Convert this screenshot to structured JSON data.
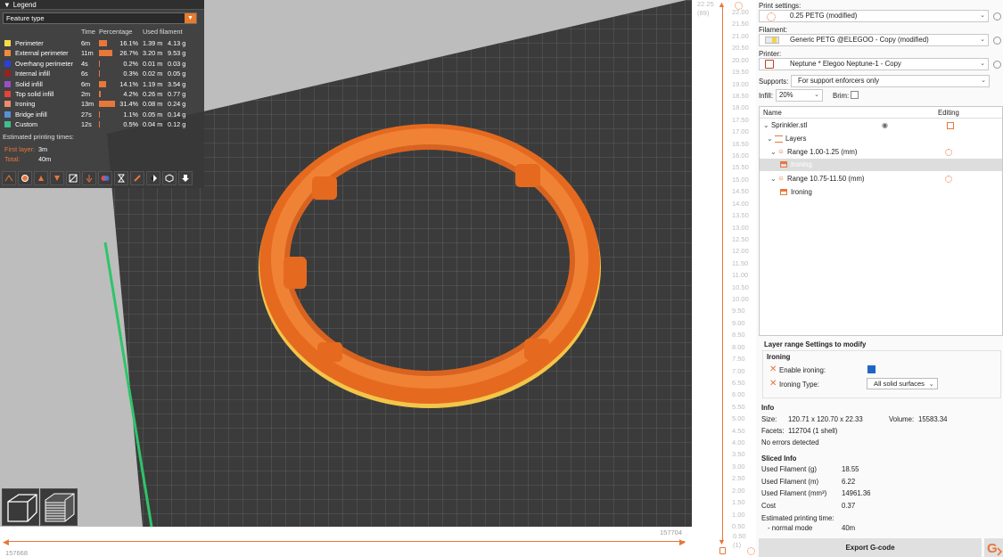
{
  "legend": {
    "title": "Legend",
    "feature_select": "Feature type",
    "columns": {
      "time": "Time",
      "percentage": "Percentage",
      "used_filament": "Used filament"
    },
    "rows": [
      {
        "name": "Perimeter",
        "color": "#f5dc4a",
        "time": "6m",
        "pct": "16.1%",
        "pct_value": 16.1,
        "meters": "1.39 m",
        "grams": "4.13 g"
      },
      {
        "name": "External perimeter",
        "color": "#ef8a3c",
        "time": "11m",
        "pct": "26.7%",
        "pct_value": 26.7,
        "meters": "3.20 m",
        "grams": "9.53 g"
      },
      {
        "name": "Overhang perimeter",
        "color": "#2b3fe0",
        "time": "4s",
        "pct": "0.2%",
        "pct_value": 0.2,
        "meters": "0.01 m",
        "grams": "0.03 g"
      },
      {
        "name": "Internal infill",
        "color": "#9c2020",
        "time": "6s",
        "pct": "0.3%",
        "pct_value": 0.3,
        "meters": "0.02 m",
        "grams": "0.05 g"
      },
      {
        "name": "Solid infill",
        "color": "#9a4fc4",
        "time": "6m",
        "pct": "14.1%",
        "pct_value": 14.1,
        "meters": "1.19 m",
        "grams": "3.54 g"
      },
      {
        "name": "Top solid infill",
        "color": "#e6423a",
        "time": "2m",
        "pct": "4.2%",
        "pct_value": 4.2,
        "meters": "0.26 m",
        "grams": "0.77 g"
      },
      {
        "name": "Ironing",
        "color": "#f08a6a",
        "time": "13m",
        "pct": "31.4%",
        "pct_value": 31.4,
        "meters": "0.08 m",
        "grams": "0.24 g"
      },
      {
        "name": "Bridge infill",
        "color": "#5a8fd6",
        "time": "27s",
        "pct": "1.1%",
        "pct_value": 1.1,
        "meters": "0.05 m",
        "grams": "0.14 g"
      },
      {
        "name": "Custom",
        "color": "#3fbf8f",
        "time": "12s",
        "pct": "0.5%",
        "pct_value": 0.5,
        "meters": "0.04 m",
        "grams": "0.12 g"
      }
    ],
    "estimated_title": "Estimated printing times:",
    "first_layer_label": "First layer:",
    "first_layer_value": "3m",
    "total_label": "Total:",
    "total_value": "40m"
  },
  "hslider": {
    "left_value": "157668",
    "right_value": "157704"
  },
  "vslider": {
    "top_value": "22.25",
    "top_layer": "(89)",
    "bottom_value": "0.50",
    "bottom_layer": "(1)",
    "ticks": [
      "22.00",
      "21.50",
      "21.00",
      "20.50",
      "20.00",
      "19.50",
      "19.00",
      "18.50",
      "18.00",
      "17.50",
      "17.00",
      "16.50",
      "16.00",
      "15.50",
      "15.00",
      "14.50",
      "14.00",
      "13.50",
      "13.00",
      "12.50",
      "12.00",
      "11.50",
      "11.00",
      "10.50",
      "10.00",
      "9.50",
      "9.00",
      "8.50",
      "8.00",
      "7.50",
      "7.00",
      "6.50",
      "6.00",
      "5.50",
      "5.00",
      "4.50",
      "4.00",
      "3.50",
      "3.00",
      "2.50",
      "2.00",
      "1.50",
      "1.00",
      "0.50"
    ]
  },
  "panel": {
    "print_settings_label": "Print settings:",
    "print_settings_value": "0.25 PETG (modified)",
    "filament_label": "Filament:",
    "filament_value": "Generic PETG @ELEGOO - Copy (modified)",
    "printer_label": "Printer:",
    "printer_value": "Neptune * Elegoo Neptune-1 - Copy",
    "supports_label": "Supports:",
    "supports_value": "For support enforcers only",
    "infill_label": "Infill:",
    "infill_value": "20%",
    "brim_label": "Brim:",
    "tree": {
      "col_name": "Name",
      "col_editing": "Editing",
      "object": "Sprinkler.stl",
      "layers": "Layers",
      "range1": "Range 1.00-1.25 (mm)",
      "range1_child": "Ironing",
      "range2": "Range 10.75-11.50 (mm)",
      "range2_child": "Ironing"
    },
    "layer_range_title": "Layer range Settings to modify",
    "ironing_group": "Ironing",
    "enable_ironing_label": "Enable ironing:",
    "ironing_type_label": "Ironing Type:",
    "ironing_type_value": "All solid surfaces",
    "info": {
      "title": "Info",
      "size_label": "Size:",
      "size_value": "120.71 x 120.70 x 22.33",
      "volume_label": "Volume:",
      "volume_value": "15583.34",
      "facets_label": "Facets:",
      "facets_value": "112704 (1 shell)",
      "errors": "No errors detected"
    },
    "sliced": {
      "title": "Sliced Info",
      "rows": [
        {
          "label": "Used Filament (g)",
          "value": "18.55"
        },
        {
          "label": "Used Filament (m)",
          "value": "6.22"
        },
        {
          "label": "Used Filament (mm³)",
          "value": "14961.36"
        },
        {
          "label": "Cost",
          "value": "0.37"
        }
      ],
      "est_label": "Estimated printing time:",
      "mode_label": "- normal mode",
      "mode_value": "40m"
    },
    "export_label": "Export G-code"
  },
  "colors": {
    "accent": "#e8773a",
    "bed": "#3a3a3a",
    "grid": "#6b6b6b"
  }
}
